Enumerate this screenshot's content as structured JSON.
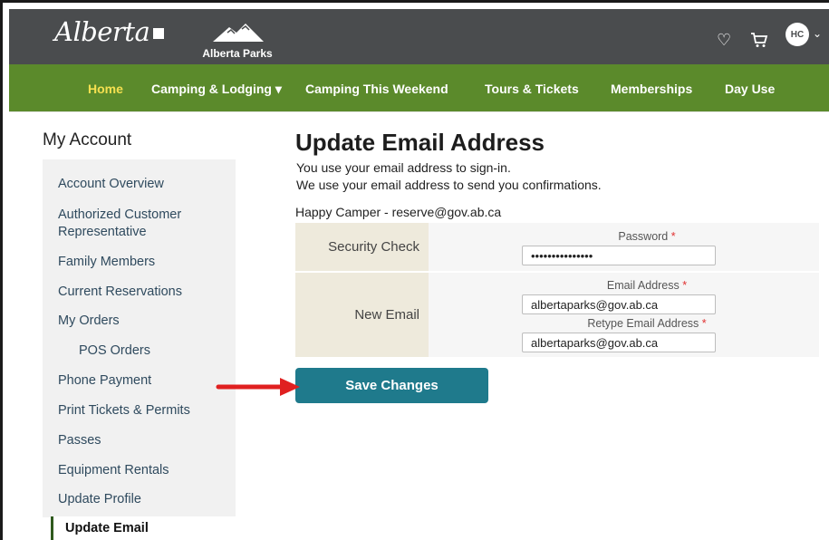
{
  "header": {
    "brand": "Alberta",
    "parks_label": "Alberta Parks",
    "icons": [
      "heart-icon",
      "cart-icon",
      "chevron-down-icon"
    ],
    "avatar_initials": "HC"
  },
  "nav": {
    "items": [
      {
        "label": "Home",
        "active": true
      },
      {
        "label": "Camping & Lodging ▾"
      },
      {
        "label": "Camping This Weekend"
      },
      {
        "label": "Tours & Tickets"
      },
      {
        "label": "Memberships"
      },
      {
        "label": "Day Use"
      }
    ]
  },
  "sidebar": {
    "title": "My Account",
    "items": [
      {
        "label": "Account Overview"
      },
      {
        "label": "Authorized Customer Representative"
      },
      {
        "label": "Family Members"
      },
      {
        "label": "Current Reservations"
      },
      {
        "label": "My Orders"
      },
      {
        "label": "POS Orders"
      },
      {
        "label": "Phone Payment"
      },
      {
        "label": "Print Tickets & Permits"
      },
      {
        "label": "Passes"
      },
      {
        "label": "Equipment Rentals"
      },
      {
        "label": "Update Profile"
      },
      {
        "label": "Update Email",
        "active": true
      }
    ]
  },
  "main": {
    "title": "Update Email Address",
    "desc1": "You use your email address to sign-in.",
    "desc2": "We use your email address to send you confirmations.",
    "user_line": "Happy Camper - reserve@gov.ab.ca",
    "security_label": "Security Check",
    "password_label": "Password",
    "password_value": "•••••••••••••••",
    "new_email_label": "New Email",
    "email_label": "Email Address",
    "email_value": "albertaparks@gov.ab.ca",
    "retype_label": "Retype Email Address",
    "retype_value": "albertaparks@gov.ab.ca",
    "required_mark": "*",
    "save_label": "Save Changes"
  },
  "colors": {
    "topbar": "#4a4c4e",
    "nav": "#5b8a2b",
    "nav_active": "#f5e050",
    "button": "#1f7a8c",
    "arrow": "#e02020"
  }
}
